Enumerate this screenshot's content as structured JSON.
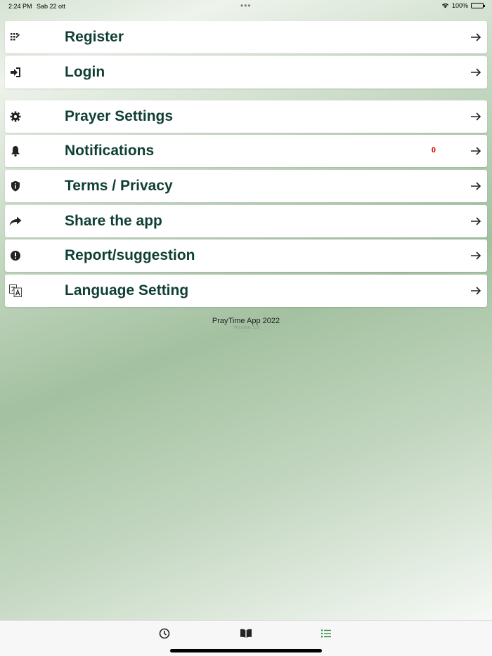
{
  "status_bar": {
    "time": "2:24 PM",
    "date": "Sab 22 ott",
    "battery": "100%",
    "battery_level": 1.0
  },
  "menu": [
    {
      "label": "Register",
      "icon": "dialpad-icon"
    },
    {
      "label": "Login",
      "icon": "sign-in-icon"
    },
    {
      "label": "Prayer Settings",
      "icon": "gear-icon"
    },
    {
      "label": "Notifications",
      "icon": "bell-icon",
      "count": "0"
    },
    {
      "label": "Terms / Privacy",
      "icon": "shield-icon"
    },
    {
      "label": "Share the app",
      "icon": "share-icon"
    },
    {
      "label": "Report/suggestion",
      "icon": "alert-icon"
    },
    {
      "label": "Language Setting",
      "icon": "translate-icon"
    }
  ],
  "footer": {
    "title": "PrayTime App 2022",
    "version": "Version 3.3"
  },
  "tabs": [
    {
      "icon": "clock-icon",
      "active": false
    },
    {
      "icon": "book-icon",
      "active": false
    },
    {
      "icon": "list-icon",
      "active": true
    }
  ],
  "colors": {
    "label": "#0f3f34",
    "count": "#e00000",
    "active_tab": "#2e8b3e",
    "inactive_tab": "#222222"
  }
}
